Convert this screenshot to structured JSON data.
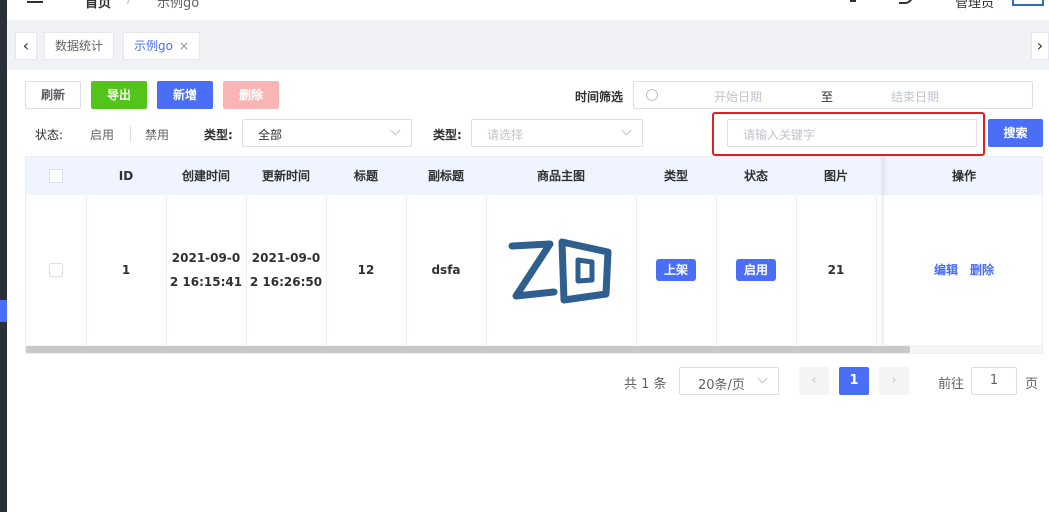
{
  "header": {
    "breadcrumb_home": "首页",
    "breadcrumb_separator": "/",
    "breadcrumb_current": "示例go",
    "user_name": "管理员"
  },
  "tags": {
    "items": [
      {
        "label": "数据统计",
        "active": false
      },
      {
        "label": "示例go",
        "active": true
      }
    ],
    "close_glyph": "×",
    "prev_glyph": "‹",
    "next_glyph": "›"
  },
  "toolbar": {
    "refresh_label": "刷新",
    "export_label": "导出",
    "add_label": "新增",
    "delete_label": "删除",
    "time_filter_label": "时间筛选",
    "date_start_placeholder": "开始日期",
    "date_separator": "至",
    "date_end_placeholder": "结束日期"
  },
  "filters": {
    "status_label": "状态:",
    "status_enabled": "启用",
    "status_disabled": "禁用",
    "type_label_1": "类型:",
    "type_value_1": "全部",
    "type_label_2": "类型:",
    "type_placeholder_2": "请选择",
    "keyword_placeholder": "请输入关键字",
    "search_label": "搜索"
  },
  "table": {
    "headers": [
      "ID",
      "创建时间",
      "更新时间",
      "标题",
      "副标题",
      "商品主图",
      "类型",
      "状态",
      "图片",
      "操作"
    ],
    "rows": [
      {
        "id": "1",
        "created_line1": "2021-09-0",
        "created_line2": "2 16:15:41",
        "updated_line1": "2021-09-0",
        "updated_line2": "2 16:26:50",
        "title": "12",
        "subtitle": "dsfa",
        "image_alt": "ZD logo",
        "type": "上架",
        "status": "启用",
        "picture": "21",
        "edit_label": "编辑",
        "delete_label": "删除"
      }
    ]
  },
  "pagination": {
    "total_text": "共 1 条",
    "page_size": "20条/页",
    "current_page": "1",
    "goto_label": "前往",
    "goto_value": "1",
    "page_suffix": "页",
    "prev_glyph": "‹",
    "next_glyph": "›"
  },
  "colors": {
    "primary": "#4a6ef5",
    "success": "#52c41a",
    "danger_disabled": "#f9b5b5",
    "highlight_border": "#e02020",
    "logo_blue": "#2f6fb0"
  }
}
